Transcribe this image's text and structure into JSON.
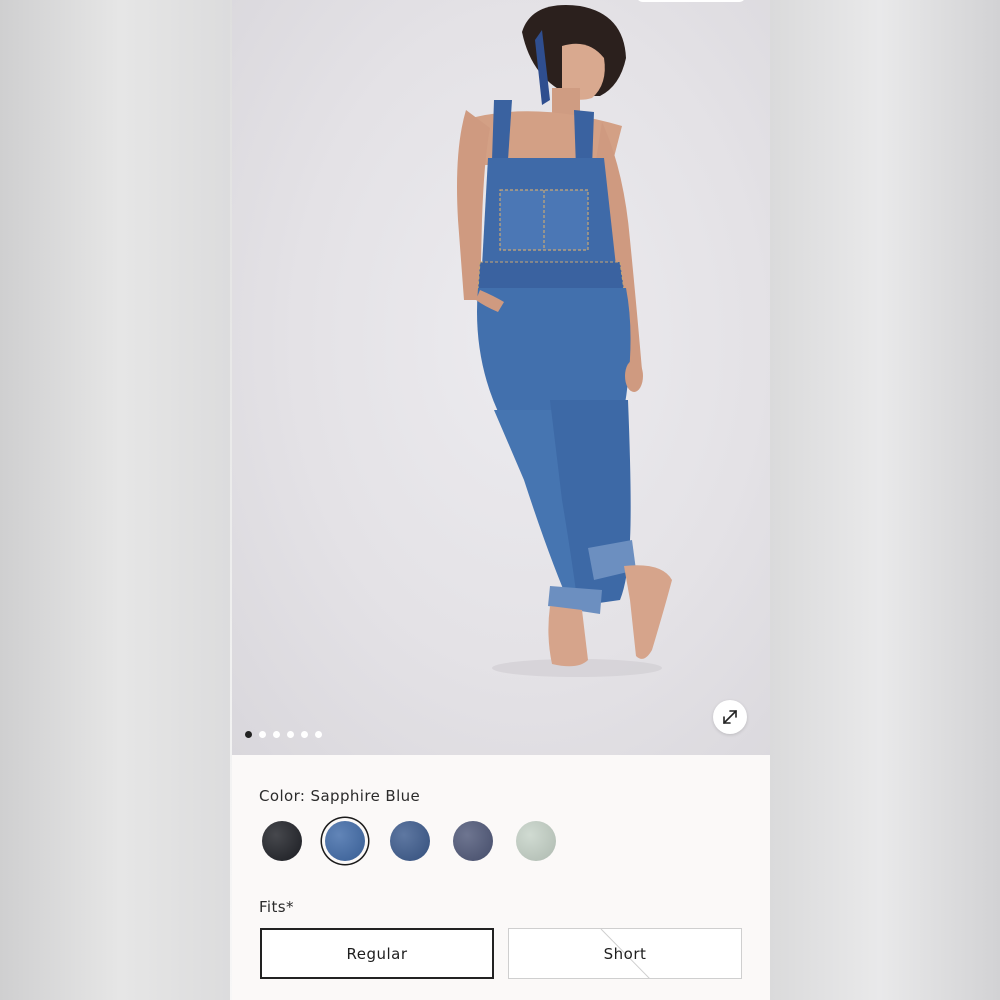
{
  "product": {
    "color_label": "Color: Sapphire Blue",
    "selected_color_index": 1,
    "swatches": [
      {
        "name": "black",
        "color": "#1e2026"
      },
      {
        "name": "sapphire-blue",
        "color": "#3f6aa8"
      },
      {
        "name": "medium-blue",
        "color": "#3b5a8d"
      },
      {
        "name": "slate-blue",
        "color": "#4e5778"
      },
      {
        "name": "sage",
        "color": "#c6d3c8"
      }
    ],
    "fits_label": "Fits*",
    "fit_options": [
      {
        "label": "Regular",
        "selected": true,
        "available": true
      },
      {
        "label": "Short",
        "selected": false,
        "available": false
      }
    ]
  },
  "gallery": {
    "image_count": 6,
    "active_index": 0,
    "expand_icon": "expand-arrows-icon"
  },
  "colors": {
    "page_bg": "#fbf9f8",
    "selected_outline": "#1b1b1b",
    "denim": "#3f6aa8"
  }
}
